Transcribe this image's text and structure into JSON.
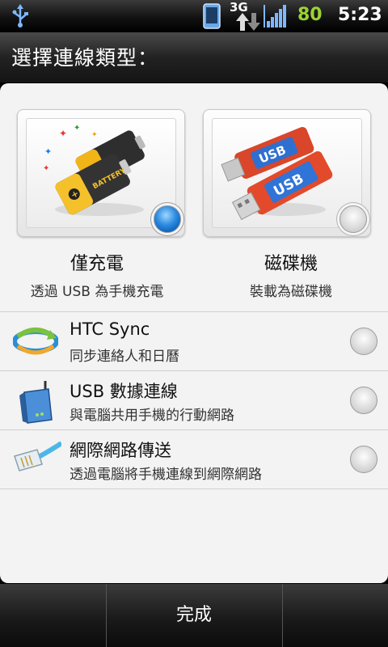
{
  "status_bar": {
    "network": "3G",
    "battery": "80",
    "time": "5:23",
    "icons": [
      "usb-icon",
      "phone-icon",
      "data-arrows-icon",
      "signal-icon"
    ]
  },
  "dialog": {
    "title": "選擇連線類型：",
    "cards": [
      {
        "title": "僅充電",
        "subtitle": "透過 USB 為手機充電",
        "selected": true,
        "icon": "battery-icon"
      },
      {
        "title": "磁碟機",
        "subtitle": "裝載為磁碟機",
        "selected": false,
        "icon": "usb-drive-icon"
      }
    ],
    "rows": [
      {
        "title": "HTC Sync",
        "subtitle": "同步連絡人和日曆",
        "selected": false,
        "icon": "htc-sync-icon"
      },
      {
        "title": "USB 數據連線",
        "subtitle": "與電腦共用手機的行動網路",
        "selected": false,
        "icon": "router-icon"
      },
      {
        "title": "網際網路傳送",
        "subtitle": "透過電腦將手機連線到網際網路",
        "selected": false,
        "icon": "ethernet-cable-icon"
      }
    ]
  },
  "bottom_bar": {
    "done_label": "完成"
  },
  "colors": {
    "accent_blue": "#1a7ad6",
    "battery_green": "#9ad234"
  }
}
